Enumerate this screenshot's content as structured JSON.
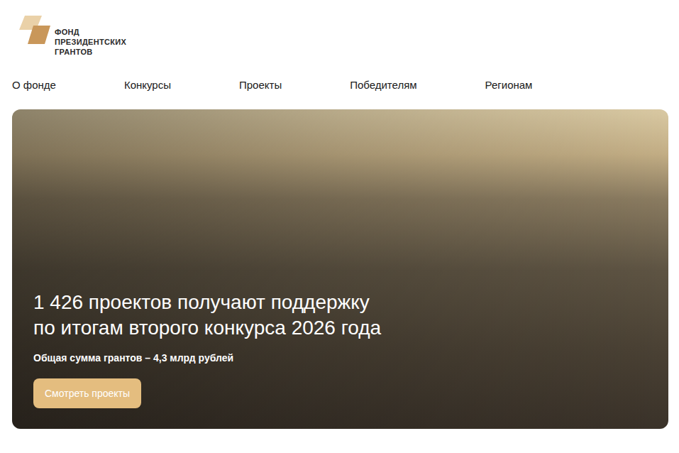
{
  "logo": {
    "lines": [
      "ФОНД",
      "ПРЕЗИДЕНТСКИХ",
      "ГРАНТОВ"
    ]
  },
  "nav": {
    "items": [
      {
        "label": "О фонде"
      },
      {
        "label": "Конкурсы"
      },
      {
        "label": "Проекты"
      },
      {
        "label": "Победителям"
      },
      {
        "label": "Регионам"
      }
    ]
  },
  "hero": {
    "title_lines": [
      "1 426 проектов получают поддержку",
      "по итогам второго конкурса 2026 года"
    ],
    "subtitle": "Общая сумма грантов – 4,3 млрд рублей",
    "button": "Смотреть проекты"
  }
}
